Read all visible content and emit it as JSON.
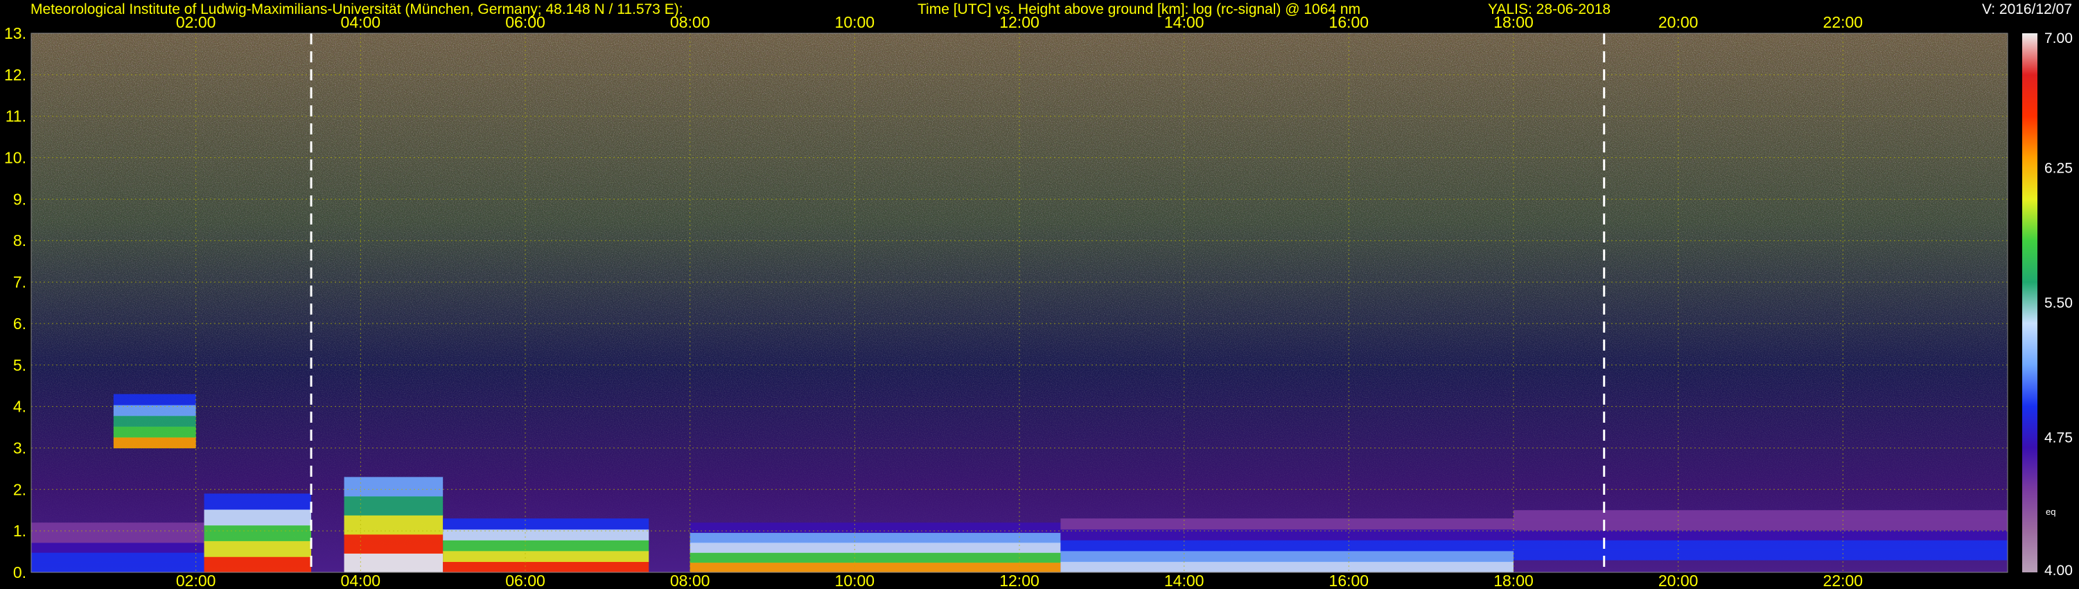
{
  "header": {
    "institute": "Meteorological Institute of Ludwig-Maximilians-Universität (München, Germany; 48.148 N / 11.573 E):",
    "title": "Time [UTC] vs. Height above ground [km]: log (rc-signal) @ 1064 nm",
    "instrument": "YALIS: 28-06-2018",
    "version": "V: 2016/12/07"
  },
  "colors": {
    "background": "#000000",
    "tick_text": "#ffff00",
    "header_text": "#ffff00",
    "version_text": "#ffffff",
    "grid": "#b8b800",
    "marker": "#ffffff"
  },
  "chart_data": {
    "type": "heatmap",
    "title": "Time [UTC] vs. Height above ground [km]: log (rc-signal) @ 1064 nm",
    "xlabel": "Time [UTC]",
    "ylabel": "Height above ground [km]",
    "xlim": [
      0,
      24
    ],
    "ylim": [
      0,
      13
    ],
    "x_ticks": [
      "02:00",
      "04:00",
      "06:00",
      "08:00",
      "10:00",
      "12:00",
      "14:00",
      "16:00",
      "18:00",
      "20:00",
      "22:00"
    ],
    "x_tick_hours": [
      2,
      4,
      6,
      8,
      10,
      12,
      14,
      16,
      18,
      20,
      22
    ],
    "y_ticks": [
      "0.",
      "1.",
      "2.",
      "3.",
      "4.",
      "5.",
      "6.",
      "7.",
      "8.",
      "9.",
      "10.",
      "11.",
      "12.",
      "13."
    ],
    "y_tick_km": [
      0,
      1,
      2,
      3,
      4,
      5,
      6,
      7,
      8,
      9,
      10,
      11,
      12,
      13
    ],
    "marker_times_utc": [
      3.4,
      19.1
    ],
    "grid": true,
    "colorbar": {
      "min": 4.0,
      "max": 7.0,
      "tick_labels": [
        "7.00",
        "6.25",
        "5.50",
        "4.75",
        "4.00"
      ],
      "tick_values": [
        7.0,
        6.25,
        5.5,
        4.75,
        4.0
      ],
      "note": "eq",
      "stops": [
        "#b8a0b8",
        "#9c6aa0",
        "#7a3aa0",
        "#3a10b0",
        "#1830f0",
        "#70a8ff",
        "#c8e0ff",
        "#20a870",
        "#40d040",
        "#e8f020",
        "#ffa000",
        "#ff3000",
        "#e02020",
        "#f0f0f0"
      ]
    },
    "layers": [
      {
        "time_utc": [
          0.0,
          2.1
        ],
        "height_km": [
          0.0,
          1.2
        ],
        "log_signal": 5.0
      },
      {
        "time_utc": [
          1.0,
          2.0
        ],
        "height_km": [
          3.0,
          4.3
        ],
        "log_signal": 6.3
      },
      {
        "time_utc": [
          2.1,
          3.4
        ],
        "height_km": [
          0.0,
          1.9
        ],
        "log_signal": 6.6
      },
      {
        "time_utc": [
          3.8,
          5.0
        ],
        "height_km": [
          0.0,
          2.3
        ],
        "log_signal": 6.9
      },
      {
        "time_utc": [
          5.0,
          7.5
        ],
        "height_km": [
          0.0,
          1.3
        ],
        "log_signal": 6.6
      },
      {
        "time_utc": [
          8.0,
          12.5
        ],
        "height_km": [
          0.0,
          1.2
        ],
        "log_signal": 6.2
      },
      {
        "time_utc": [
          12.5,
          18.0
        ],
        "height_km": [
          0.0,
          1.3
        ],
        "log_signal": 5.3
      },
      {
        "time_utc": [
          18.0,
          24.0
        ],
        "height_km": [
          0.3,
          1.5
        ],
        "log_signal": 5.0
      }
    ]
  }
}
